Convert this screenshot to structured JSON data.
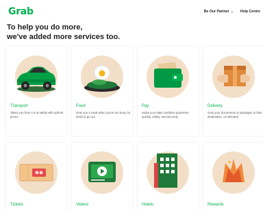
{
  "header": {
    "logo": "Grab",
    "nav": [
      {
        "label": "Be Our Partner",
        "chevron": true
      },
      {
        "label": "Help Centre",
        "chevron": false
      }
    ]
  },
  "headline": {
    "line1": "To help you do more,",
    "line2": "we've added more services too."
  },
  "services": [
    {
      "title": "Transport",
      "description": "Takes you from A to B safely with upfront prices.",
      "icon": "car-icon"
    },
    {
      "title": "Food",
      "description": "Gets you a meal when you're too busy (or tired) to go out.",
      "icon": "food-plate-icon"
    },
    {
      "title": "Pay",
      "description": "Helps you make cashless payments quickly, safely, and securely.",
      "icon": "wallet-icon"
    },
    {
      "title": "Delivery",
      "description": "Gets your documents or packages to their destination, on-demand.",
      "icon": "package-icon"
    },
    {
      "title": "Tickets",
      "icon": "ticket-icon"
    },
    {
      "title": "Videos",
      "icon": "video-play-icon"
    },
    {
      "title": "Hotels",
      "icon": "hotel-icon"
    },
    {
      "title": "Rewards",
      "icon": "rewards-icon"
    }
  ],
  "colors": {
    "brand": "#00b14f",
    "circle": "#f3dfc8"
  }
}
